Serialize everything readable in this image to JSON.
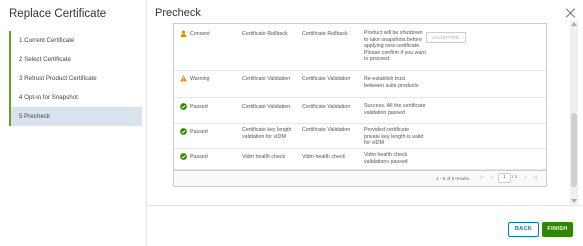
{
  "wizard": {
    "title": "Replace Certificate",
    "steps": [
      {
        "label": "1 Current Certificate"
      },
      {
        "label": "2 Select Certificate"
      },
      {
        "label": "3 Retrust Product Certificate"
      },
      {
        "label": "4 Opt-in for Snapshot"
      },
      {
        "label": "5 Precheck"
      }
    ]
  },
  "page": {
    "title": "Precheck"
  },
  "table": {
    "rows": [
      {
        "status": "Consent",
        "status_color": "#e08b00",
        "icon": "person-icon",
        "name": "Certificate Rollback",
        "type": "Certificate Rollback",
        "message": "Product will be shutdown to take snapshots before applying new certificate. Please confirm if you want to proceed",
        "action": "ACCEPTED"
      },
      {
        "status": "Warning",
        "status_color": "#e08b00",
        "icon": "warning-icon",
        "name": "Certificate Validation",
        "type": "Certificate Validation",
        "message": "Re-establish trust between suite products"
      },
      {
        "status": "Passed",
        "status_color": "#318700",
        "icon": "check-circle-icon",
        "name": "Certificate Validation",
        "type": "Certificate Validation",
        "message": "Success. All the certificate validation passed"
      },
      {
        "status": "Passed",
        "status_color": "#318700",
        "icon": "check-circle-icon",
        "name": "Certificate key length validation for vIDM",
        "type": "Certificate Validation",
        "message": "Provided certificate private key length is valid for vIDM"
      },
      {
        "status": "Passed",
        "status_color": "#318700",
        "icon": "check-circle-icon",
        "name": "Vidm health check",
        "type": "Vidm health check",
        "message": "Vidm health check validations passed"
      }
    ],
    "pagination": {
      "summary": "1 - 5 of 5 results",
      "page": "1",
      "total": "/ 1"
    }
  },
  "buttons": {
    "back": "BACK",
    "finish": "FINISH"
  }
}
